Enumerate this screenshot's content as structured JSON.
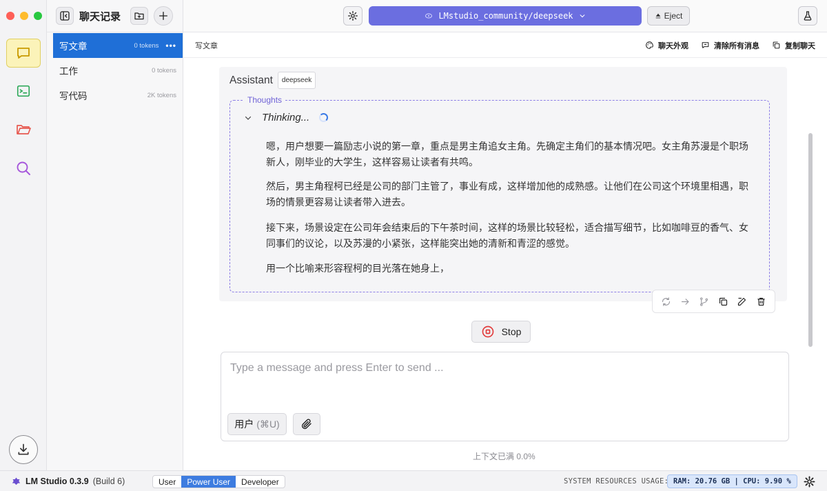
{
  "sidebar": {
    "title": "聊天记录",
    "chats": [
      {
        "name": "写文章",
        "tokens": "0 tokens",
        "more": "•••"
      },
      {
        "name": "工作",
        "tokens": "0 tokens"
      },
      {
        "name": "写代码",
        "tokens": "2K tokens"
      }
    ]
  },
  "topbar": {
    "model": "LMstudio_community/deepseek",
    "eject_label": "Eject"
  },
  "chat_header": {
    "breadcrumb": "写文章",
    "actions": [
      "聊天外观",
      "清除所有消息",
      "复制聊天"
    ]
  },
  "message": {
    "role": "Assistant",
    "model_tag": "deepseek",
    "thoughts_label": "Thoughts",
    "thinking_label": "Thinking...",
    "paragraphs": [
      "嗯，用户想要一篇励志小说的第一章，重点是男主角追女主角。先确定主角们的基本情况吧。女主角苏漫是个职场新人，刚毕业的大学生，这样容易让读者有共鸣。",
      "然后，男主角程柯已经是公司的部门主管了，事业有成，这样增加他的成熟感。让他们在公司这个环境里相遇，职场的情景更容易让读者带入进去。",
      "接下来，场景设定在公司年会结束后的下午茶时间，这样的场景比较轻松，适合描写细节，比如咖啡豆的香气、女同事们的议论，以及苏漫的小紧张，这样能突出她的清新和青涩的感觉。",
      "用一个比喻来形容程柯的目光落在她身上，"
    ]
  },
  "stop_label": "Stop",
  "composer": {
    "placeholder": "Type a message and press Enter to send ...",
    "role_label": "用户",
    "role_shortcut": "(⌘U)",
    "context_status": "上下文已满 0.0%"
  },
  "status": {
    "app_name": "LM Studio 0.3.9",
    "build": "(Build 6)",
    "modes": [
      "User",
      "Power User",
      "Developer"
    ],
    "active_mode": "Power User",
    "resources_label": "SYSTEM RESOURCES USAGE:",
    "resources_value": "RAM: 20.76 GB  |  CPU: 9.90 %"
  },
  "colors": {
    "accent": "#6b6ee0",
    "selected": "#1f6fd7",
    "thoughts_border": "#8d7fe6"
  }
}
